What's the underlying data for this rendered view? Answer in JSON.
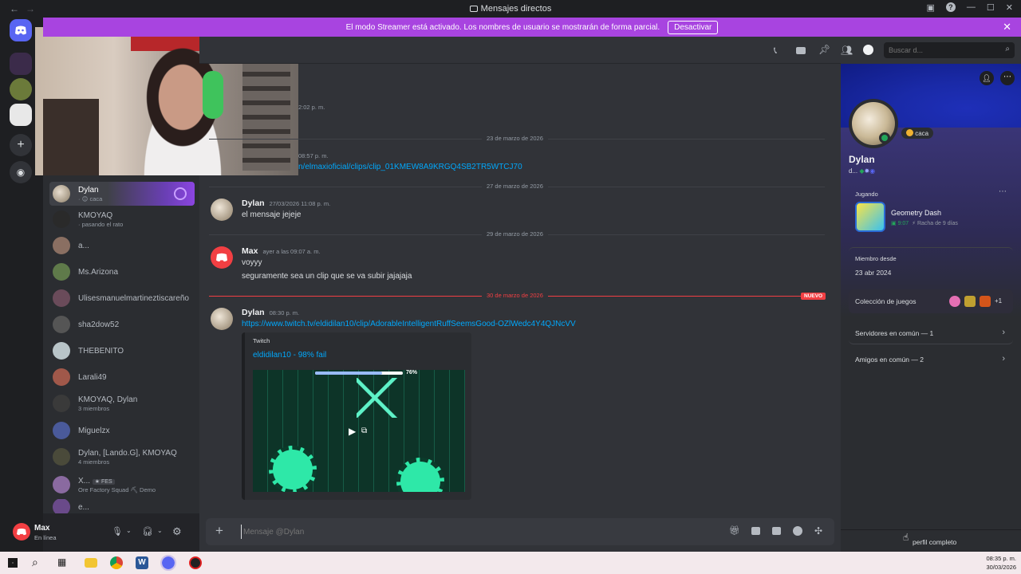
{
  "window": {
    "title": "Mensajes directos"
  },
  "banner": {
    "text": "El modo Streamer está activado. Los nombres de usuario se mostrarán de forma parcial.",
    "button": "Desactivar"
  },
  "search": {
    "placeholder": "Buscar d..."
  },
  "dms": [
    {
      "name": "Dylan",
      "sub": "· 😊 caca"
    },
    {
      "name": "KMOYAQ",
      "sub": "· pasando el rato"
    },
    {
      "name": "a...",
      "sub": ""
    },
    {
      "name": "Ms.Arizona",
      "sub": ""
    },
    {
      "name": "Ulisesmanuelmartineztiscareño",
      "sub": ""
    },
    {
      "name": "sha2dow52",
      "sub": ""
    },
    {
      "name": "THEBENITO",
      "sub": ""
    },
    {
      "name": "Larali49",
      "sub": ""
    },
    {
      "name": "KMOYAQ, Dylan",
      "sub": "3 miembros"
    },
    {
      "name": "Miguelzx",
      "sub": ""
    },
    {
      "name": "Dylan, [Lando.G], KMOYAQ",
      "sub": "4 miembros"
    },
    {
      "name": "X...",
      "tag": "FES",
      "sub": "Ore Factory Squad ⛏ Demo"
    },
    {
      "name": "e...",
      "sub": ""
    }
  ],
  "user": {
    "name": "Max",
    "status": "En línea"
  },
  "chat": {
    "partial_time": "2:02 p. m.",
    "date1": "23 de marzo de 2026",
    "partial_time2": "08:57 p. m.",
    "partial_link": "n/elmaxioficial/clips/clip_01KMEW8A9KRGQ4SB2TR5WTCJ70",
    "date2": "27 de marzo de 2026",
    "m1": {
      "author": "Dylan",
      "time": "27/03/2026 11:08 p. m.",
      "text": "el mensaje jejeje"
    },
    "date3": "29 de marzo de 2026",
    "m2": {
      "author": "Max",
      "time": "ayer a las 09:07 a. m.",
      "line1": "voyyy",
      "line2": "seguramente sea un clip que se va subir jajajaja"
    },
    "date4": "30 de marzo de 2026",
    "new_badge": "NUEVO",
    "m3": {
      "author": "Dylan",
      "time": "08:30 p. m.",
      "link": "https://www.twitch.tv/eldidilan10/clip/AdorableIntelligentRuffSeemsGood-OZlWedc4Y4QJNcVV",
      "embed_provider": "Twitch",
      "embed_title": "eldidilan10 - 98% fail",
      "embed_overlay": "76%"
    },
    "input_placeholder": "Mensaje @Dylan"
  },
  "profile": {
    "status": "caca",
    "name": "Dylan",
    "handle": "d...",
    "playing_label": "Jugando",
    "game": "Geometry Dash",
    "game_time": "9:07",
    "game_streak": "Racha de 9 días",
    "member_since_label": "Miembro desde",
    "member_since": "23 abr 2024",
    "collection_label": "Colección de juegos",
    "collection_more": "+1",
    "servers": "Servidores en común — 1",
    "friends": "Amigos en común — 2",
    "full_profile": "perfil completo"
  },
  "taskbar": {
    "time": "08:35 p. m.",
    "date": "30/03/2026"
  },
  "colors": {
    "accent": "#5865f2",
    "banner": "#a844e0",
    "online": "#23a55a",
    "link": "#00a8fc",
    "new": "#f23f43"
  }
}
